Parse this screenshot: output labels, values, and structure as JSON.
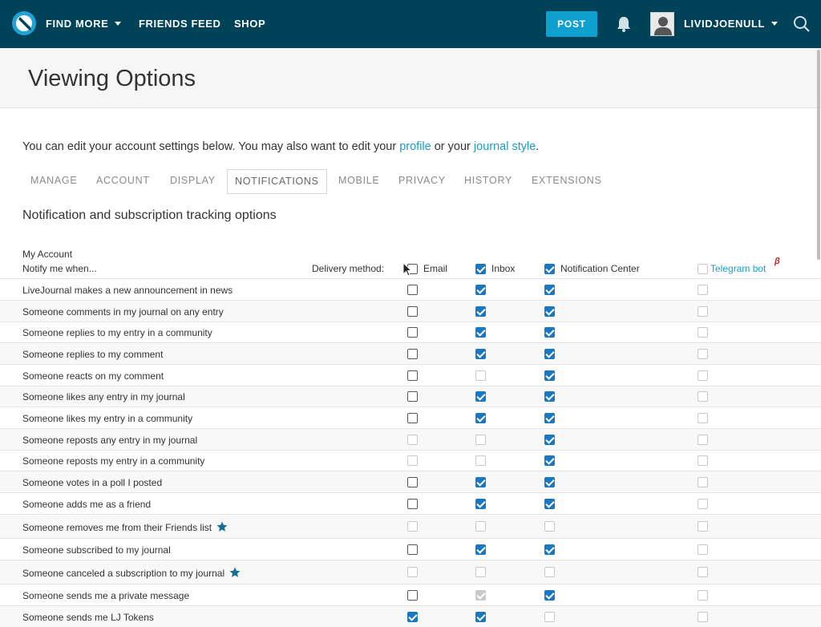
{
  "header": {
    "nav": [
      "FIND MORE",
      "FRIENDS FEED",
      "SHOP"
    ],
    "post_label": "POST",
    "username": "LIVIDJOENULL"
  },
  "page": {
    "title": "Viewing Options",
    "intro_text": "You can edit your account settings below. You may also want to edit your ",
    "intro_link_profile": "profile",
    "intro_mid": " or your ",
    "intro_link_style": "journal style",
    "intro_end": "."
  },
  "tabs": [
    "MANAGE",
    "ACCOUNT",
    "DISPLAY",
    "NOTIFICATIONS",
    "MOBILE",
    "PRIVACY",
    "HISTORY",
    "EXTENSIONS"
  ],
  "active_tab": "NOTIFICATIONS",
  "notifications": {
    "section_title": "Notification and subscription tracking options",
    "group_label": "My Account",
    "notify_label": "Notify me when...",
    "delivery_label": "Delivery method:",
    "columns": [
      "Email",
      "Inbox",
      "Notification Center",
      "Telegram bot"
    ],
    "beta_mark": "β",
    "column_defaults": {
      "email": {
        "checked": false,
        "disabled": false
      },
      "inbox": {
        "checked": true,
        "disabled": false
      },
      "notification_center": {
        "checked": true,
        "disabled": false
      },
      "telegram": {
        "checked": false,
        "disabled": true
      }
    },
    "rows": [
      {
        "label": "LiveJournal makes a new announcement in news",
        "email": [
          false,
          false
        ],
        "inbox": [
          true,
          false
        ],
        "nc": [
          true,
          false
        ],
        "tg": [
          false,
          true
        ]
      },
      {
        "label": "Someone comments in my journal on any entry",
        "email": [
          false,
          false
        ],
        "inbox": [
          true,
          false
        ],
        "nc": [
          true,
          false
        ],
        "tg": [
          false,
          true
        ]
      },
      {
        "label": "Someone replies to my entry in a community",
        "email": [
          false,
          false
        ],
        "inbox": [
          true,
          false
        ],
        "nc": [
          true,
          false
        ],
        "tg": [
          false,
          true
        ]
      },
      {
        "label": "Someone replies to my comment",
        "email": [
          false,
          false
        ],
        "inbox": [
          true,
          false
        ],
        "nc": [
          true,
          false
        ],
        "tg": [
          false,
          true
        ]
      },
      {
        "label": "Someone reacts on my comment",
        "email": [
          false,
          false
        ],
        "inbox": [
          false,
          true
        ],
        "nc": [
          true,
          false
        ],
        "tg": [
          false,
          true
        ]
      },
      {
        "label": "Someone likes any entry in my journal",
        "email": [
          false,
          false
        ],
        "inbox": [
          true,
          false
        ],
        "nc": [
          true,
          false
        ],
        "tg": [
          false,
          true
        ]
      },
      {
        "label": "Someone likes my entry in a community",
        "email": [
          false,
          false
        ],
        "inbox": [
          true,
          false
        ],
        "nc": [
          true,
          false
        ],
        "tg": [
          false,
          true
        ]
      },
      {
        "label": "Someone reposts any entry in my journal",
        "email": [
          false,
          true
        ],
        "inbox": [
          false,
          true
        ],
        "nc": [
          true,
          false
        ],
        "tg": [
          false,
          true
        ]
      },
      {
        "label": "Someone reposts my entry in a community",
        "email": [
          false,
          true
        ],
        "inbox": [
          false,
          true
        ],
        "nc": [
          true,
          false
        ],
        "tg": [
          false,
          true
        ]
      },
      {
        "label": "Someone votes in a poll I posted",
        "email": [
          false,
          false
        ],
        "inbox": [
          true,
          false
        ],
        "nc": [
          true,
          false
        ],
        "tg": [
          false,
          true
        ]
      },
      {
        "label": "Someone adds me as a friend",
        "email": [
          false,
          false
        ],
        "inbox": [
          true,
          false
        ],
        "nc": [
          true,
          false
        ],
        "tg": [
          false,
          true
        ]
      },
      {
        "label": "Someone removes me from their Friends list",
        "star": true,
        "email": [
          false,
          true
        ],
        "inbox": [
          false,
          true
        ],
        "nc": [
          false,
          true
        ],
        "tg": [
          false,
          true
        ]
      },
      {
        "label": "Someone subscribed to my journal",
        "email": [
          false,
          false
        ],
        "inbox": [
          true,
          false
        ],
        "nc": [
          true,
          false
        ],
        "tg": [
          false,
          true
        ]
      },
      {
        "label": "Someone canceled a subscription to my journal",
        "star": true,
        "email": [
          false,
          true
        ],
        "inbox": [
          false,
          true
        ],
        "nc": [
          false,
          true
        ],
        "tg": [
          false,
          true
        ]
      },
      {
        "label": "Someone sends me a private message",
        "email": [
          false,
          false
        ],
        "inbox": [
          true,
          true
        ],
        "nc": [
          true,
          false
        ],
        "tg": [
          false,
          true
        ]
      },
      {
        "label": "Someone sends me LJ Tokens",
        "email": [
          true,
          false
        ],
        "inbox": [
          true,
          false
        ],
        "nc": [
          false,
          true
        ],
        "tg": [
          false,
          true
        ]
      }
    ]
  },
  "colors": {
    "topbar": "#004359",
    "accent": "#0fa0cf",
    "link": "#1b9cc9",
    "checkbox": "#1a78c2",
    "star": "#1a6f96"
  }
}
